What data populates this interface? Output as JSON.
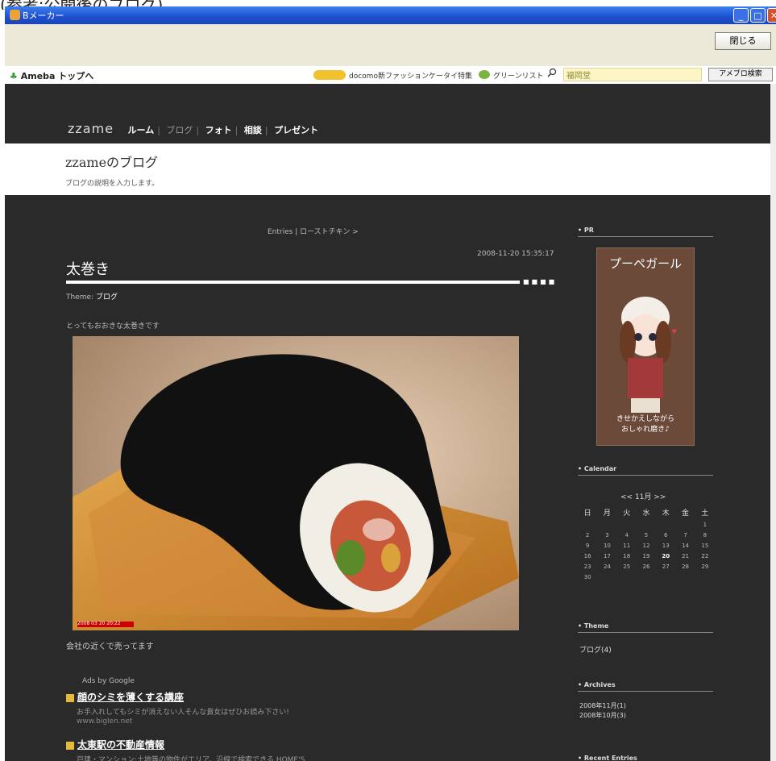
{
  "caption": "(参考:公開後のブログ)",
  "window": {
    "app_title": "Bメーカー",
    "min": "_",
    "max": "□",
    "close": "✕"
  },
  "toolbar": {
    "close_label": "閉じる"
  },
  "ameba_bar": {
    "logo": "Ameba トップへ",
    "promo": "docomo新ファッションケータイ特集",
    "greenlist": "グリーンリスト",
    "search_value": "福岡堂",
    "search_button": "アメブロ検索"
  },
  "blog": {
    "nav": {
      "brand": "zzame",
      "items": [
        "ルーム",
        "ブログ",
        "フォト",
        "相談",
        "プレゼント"
      ]
    },
    "title": "zzameのブログ",
    "description": "ブログの説明を入力します。"
  },
  "entry": {
    "nav": "Entries | ローストチキン >",
    "date": "2008-11-20 15:35:17",
    "title": "太巻き",
    "theme_prefix": "Theme:",
    "theme_value": "ブログ",
    "intro": "とってもおおきな太巻きです",
    "photo_stamp": "2008 03 20 20:22",
    "caption": "会社の近くで売ってます"
  },
  "ads": {
    "label": "Ads by Google",
    "items": [
      {
        "title": "顔のシミを薄くする講座",
        "desc": "お手入れしてもシミが消えない人そんな貴女はぜひお読み下さい!",
        "url": "www.biglen.net"
      },
      {
        "title": "太東駅の不動産情報",
        "desc": "戸建・マンション:土地等の物件がエリア、沿線で検索できる HOME'S",
        "url": ""
      }
    ]
  },
  "sidebar": {
    "pr_header": "• PR",
    "pr_banner": {
      "title": "プーペガール",
      "line1": "きせかえしながら",
      "line2": "おしゃれ磨き♪"
    },
    "calendar_header": "• Calendar",
    "calendar_nav": "<< 11月 >>",
    "calendar_dow": [
      "日",
      "月",
      "火",
      "水",
      "木",
      "金",
      "土"
    ],
    "calendar_weeks": [
      [
        "",
        "",
        "",
        "",
        "",
        "",
        "1"
      ],
      [
        "2",
        "3",
        "4",
        "5",
        "6",
        "7",
        "8"
      ],
      [
        "9",
        "10",
        "11",
        "12",
        "13",
        "14",
        "15"
      ],
      [
        "16",
        "17",
        "18",
        "19",
        "20",
        "21",
        "22"
      ],
      [
        "23",
        "24",
        "25",
        "26",
        "27",
        "28",
        "29"
      ],
      [
        "30",
        "",
        "",
        "",
        "",
        "",
        ""
      ]
    ],
    "calendar_today": "20",
    "theme_header": "• Theme",
    "theme_item": "ブログ(4)",
    "archives_header": "• Archives",
    "archives": [
      "2008年11月(1)",
      "2008年10月(3)"
    ],
    "recent_header": "• Recent Entries"
  }
}
